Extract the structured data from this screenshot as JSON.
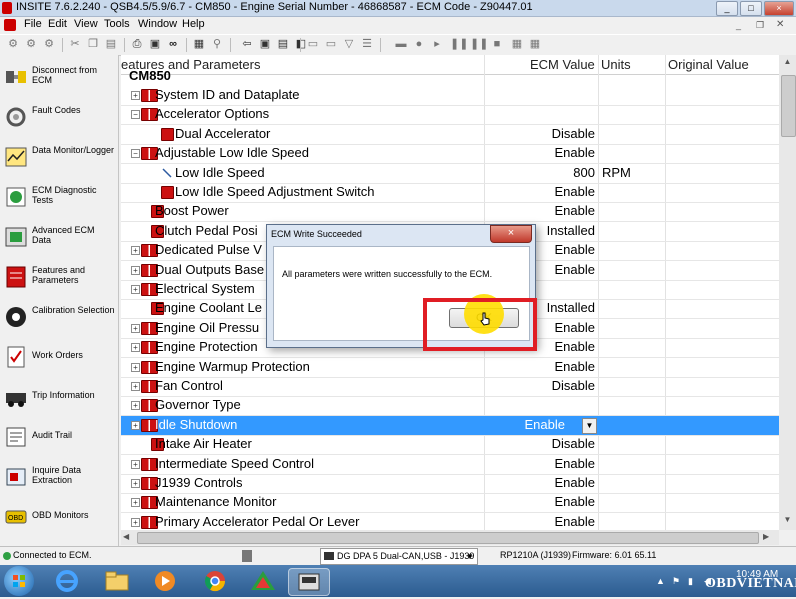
{
  "window": {
    "title": "INSITE 7.6.2.240  -  QSB4.5/5.9/6.7  - CM850  -  Engine Serial Number  -  46868587  -  ECM Code  -  Z90447.01",
    "min_glyph": "_",
    "max_glyph": "□",
    "close_glyph": "×"
  },
  "menu": [
    "File",
    "Edit",
    "View",
    "Tools",
    "Window",
    "Help"
  ],
  "sidebar": [
    {
      "label": "Disconnect from ECM",
      "icon": "disconnect-icon"
    },
    {
      "label": "Fault Codes",
      "icon": "fault-codes-icon"
    },
    {
      "label": "Data Monitor/Logger",
      "icon": "data-monitor-icon"
    },
    {
      "label": "ECM Diagnostic Tests",
      "icon": "diagnostic-tests-icon"
    },
    {
      "label": "Advanced ECM Data",
      "icon": "advanced-ecm-icon"
    },
    {
      "label": "Features and Parameters",
      "icon": "features-icon"
    },
    {
      "label": "Calibration Selection",
      "icon": "calibration-icon"
    },
    {
      "label": "Work Orders",
      "icon": "work-orders-icon"
    },
    {
      "label": "Trip Information",
      "icon": "trip-info-icon"
    },
    {
      "label": "Audit Trail",
      "icon": "audit-trail-icon"
    },
    {
      "label": "Inquire Data Extraction",
      "icon": "inquire-icon"
    },
    {
      "label": "OBD Monitors",
      "icon": "obd-icon"
    }
  ],
  "grid": {
    "headers": {
      "name": "eatures and Parameters",
      "ecm_value": "ECM Value",
      "units": "Units",
      "original_value": "Original Value"
    },
    "group_label": "CM850",
    "rows": [
      {
        "name": "System ID and Dataplate",
        "value": "",
        "unit": "",
        "expander": "+",
        "indent": 0,
        "icon": "folder"
      },
      {
        "name": "Accelerator Options",
        "value": "",
        "unit": "",
        "expander": "−",
        "indent": 0,
        "icon": "folder"
      },
      {
        "name": "Dual Accelerator",
        "value": "Disable",
        "unit": "",
        "expander": "",
        "indent": 1,
        "icon": "param"
      },
      {
        "name": "Adjustable Low Idle Speed",
        "value": "Enable",
        "unit": "",
        "expander": "−",
        "indent": 0,
        "icon": "folder"
      },
      {
        "name": "Low Idle Speed",
        "value": "800",
        "unit": "RPM",
        "expander": "",
        "indent": 1,
        "icon": "slash"
      },
      {
        "name": "Low Idle Speed Adjustment Switch",
        "value": "Enable",
        "unit": "",
        "expander": "",
        "indent": 1,
        "icon": "param"
      },
      {
        "name": "Boost Power",
        "value": "Enable",
        "unit": "",
        "expander": "",
        "indent": 0,
        "icon": "param"
      },
      {
        "name": "Clutch Pedal Posi",
        "value": "Installed",
        "unit": "",
        "expander": "",
        "indent": 0,
        "icon": "param"
      },
      {
        "name": "Dedicated Pulse V",
        "value": "Enable",
        "unit": "",
        "expander": "+",
        "indent": 0,
        "icon": "folder"
      },
      {
        "name": "Dual Outputs Base",
        "value": "Enable",
        "unit": "",
        "expander": "+",
        "indent": 0,
        "icon": "folder"
      },
      {
        "name": "Electrical System",
        "value": "",
        "unit": "",
        "expander": "+",
        "indent": 0,
        "icon": "folder"
      },
      {
        "name": "Engine Coolant Le",
        "value": "Installed",
        "unit": "",
        "expander": "",
        "indent": 0,
        "icon": "param"
      },
      {
        "name": "Engine Oil Pressu",
        "value": "Enable",
        "unit": "",
        "expander": "+",
        "indent": 0,
        "icon": "folder"
      },
      {
        "name": "Engine Protection",
        "value": "Enable",
        "unit": "",
        "expander": "+",
        "indent": 0,
        "icon": "folder"
      },
      {
        "name": "Engine Warmup Protection",
        "value": "Enable",
        "unit": "",
        "expander": "+",
        "indent": 0,
        "icon": "folder"
      },
      {
        "name": "Fan Control",
        "value": "Disable",
        "unit": "",
        "expander": "+",
        "indent": 0,
        "icon": "folder"
      },
      {
        "name": "Governor Type",
        "value": "",
        "unit": "",
        "expander": "+",
        "indent": 0,
        "icon": "folder"
      },
      {
        "name": "Idle Shutdown",
        "value": "Enable",
        "unit": "",
        "expander": "+",
        "indent": 0,
        "icon": "folder",
        "selected": true
      },
      {
        "name": "Intake Air Heater",
        "value": "Disable",
        "unit": "",
        "expander": "",
        "indent": 0,
        "icon": "param"
      },
      {
        "name": "Intermediate Speed Control",
        "value": "Enable",
        "unit": "",
        "expander": "+",
        "indent": 0,
        "icon": "folder"
      },
      {
        "name": "J1939 Controls",
        "value": "Enable",
        "unit": "",
        "expander": "+",
        "indent": 0,
        "icon": "folder"
      },
      {
        "name": "Maintenance Monitor",
        "value": "Enable",
        "unit": "",
        "expander": "+",
        "indent": 0,
        "icon": "folder"
      },
      {
        "name": "Primary Accelerator Pedal Or Lever",
        "value": "Enable",
        "unit": "",
        "expander": "+",
        "indent": 0,
        "icon": "folder"
      }
    ]
  },
  "dialog": {
    "title": "ECM Write Succeeded",
    "message": "All parameters were written successfully to the ECM.",
    "ok_label": "OK",
    "close_glyph": "×"
  },
  "status": {
    "connection": "Connected to ECM.",
    "adapter": "DG DPA 5 Dual-CAN,USB - J1939",
    "protocol": "RP1210A (J1939)",
    "firmware": "Firmware: 6.01 65.11"
  },
  "taskbar": {
    "time": "10:49 AM",
    "apps": [
      "ie-icon",
      "explorer-icon",
      "media-player-icon",
      "chrome-icon",
      "app-icon",
      "insite-icon"
    ]
  },
  "watermark": "OBDVIETNAM",
  "colors": {
    "selection": "#3399ff",
    "param_icon": "#cc1111",
    "highlight_box": "#e01d24",
    "cursor_halo": "#ffdd00"
  }
}
